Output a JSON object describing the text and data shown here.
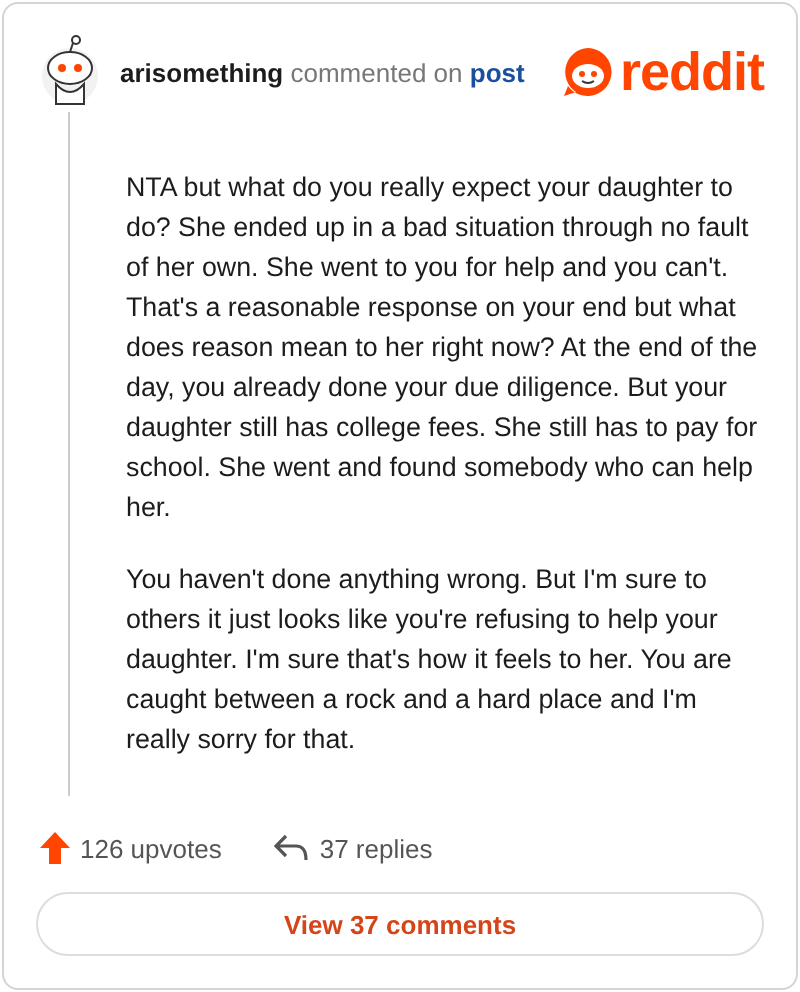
{
  "header": {
    "username": "arisomething",
    "action": "commented on",
    "link": "post",
    "logo_text": "reddit"
  },
  "comment": {
    "paragraphs": [
      "NTA but what do you really expect your daughter to do? She ended up in a bad situation through no fault of her own. She went to you for help and you can't. That's a reasonable response on your end but what does reason mean to her right now? At the end of the day, you already done your due diligence. But your daughter still has college fees. She still has to pay for school. She went and found somebody who can help her.",
      "You haven't done anything wrong. But I'm sure to others it just looks like you're refusing to help your daughter. I'm sure that's how it feels to her. You are caught between a rock and a hard place and I'm really sorry for that."
    ]
  },
  "footer": {
    "upvotes": "126 upvotes",
    "replies": "37 replies"
  },
  "button": {
    "label": "View 37 comments"
  }
}
